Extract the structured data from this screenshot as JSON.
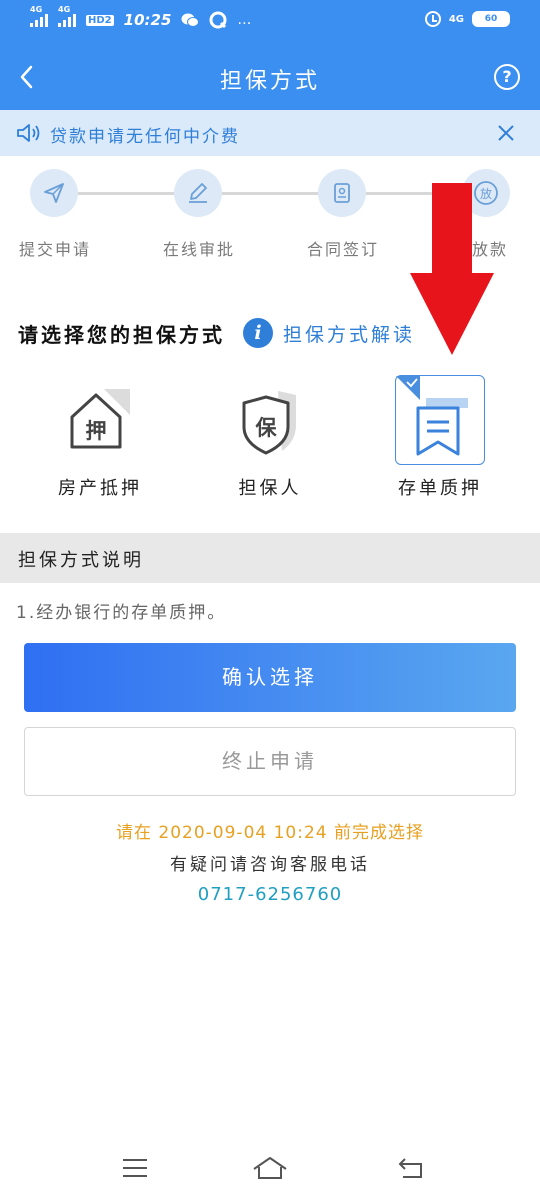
{
  "status_bar": {
    "signal_1": "4G",
    "signal_2": "4G",
    "hd": "HD2",
    "time": "10:25",
    "more": "…",
    "network": "4G",
    "battery": "60"
  },
  "header": {
    "title": "担保方式"
  },
  "notice": {
    "text": "贷款申请无任何中介费"
  },
  "steps": [
    {
      "label": "提交申请",
      "icon": "send-icon"
    },
    {
      "label": "在线审批",
      "icon": "pencil-icon"
    },
    {
      "label": "合同签订",
      "icon": "contract-icon"
    },
    {
      "label": "放款",
      "icon": "loan-release-icon",
      "icon_text": "放"
    }
  ],
  "section": {
    "title": "请选择您的担保方式",
    "info_link": "担保方式解读"
  },
  "options": [
    {
      "label": "房产抵押",
      "icon_text": "押",
      "selected": false
    },
    {
      "label": "担保人",
      "icon_text": "保",
      "selected": false
    },
    {
      "label": "存单质押",
      "selected": true
    }
  ],
  "description": {
    "title": "担保方式说明",
    "text": "1.经办银行的存单质押。"
  },
  "buttons": {
    "confirm": "确认选择",
    "stop": "终止申请"
  },
  "footer": {
    "deadline": "请在 2020-09-04 10:24 前完成选择",
    "hotline_label": "有疑问请咨询客服电话",
    "phone": "0717-6256760"
  },
  "colors": {
    "brand_blue": "#3b8ff0",
    "accent_orange": "#e8a021",
    "phone_teal": "#1f9fc2",
    "arrow_red": "#e8141c"
  }
}
